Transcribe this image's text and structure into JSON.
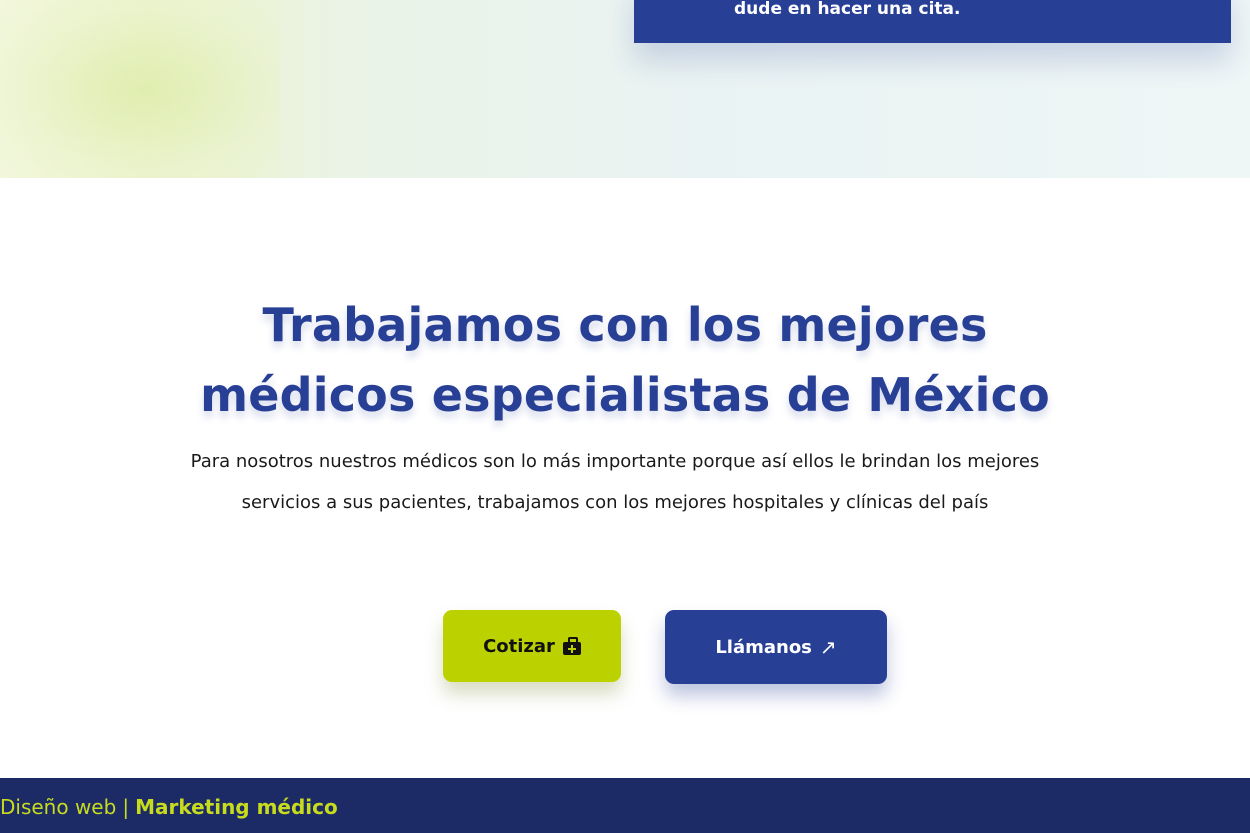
{
  "hero": {
    "card_text": "dude en hacer una cita."
  },
  "main": {
    "headline_line1": "Trabajamos con los mejores",
    "headline_line2": "médicos especialistas de México",
    "subtext_line1": "Para nosotros nuestros médicos son lo más importante porque así ellos le brindan los mejores",
    "subtext_line2": "servicios a sus pacientes, trabajamos con los mejores hospitales y clínicas del país"
  },
  "buttons": {
    "cotizar_label": "Cotizar",
    "cotizar_icon": "medical-kit-icon",
    "llamanos_label": "Llámanos",
    "llamanos_icon": "arrow-up-right-icon"
  },
  "footer": {
    "link1": "Diseño web",
    "separator": "|",
    "link2": "Marketing médico"
  },
  "colors": {
    "brand_blue": "#283f96",
    "accent_lime": "#bcd200",
    "footer_navy": "#1c2a66",
    "footer_text": "#c8dc1e"
  }
}
